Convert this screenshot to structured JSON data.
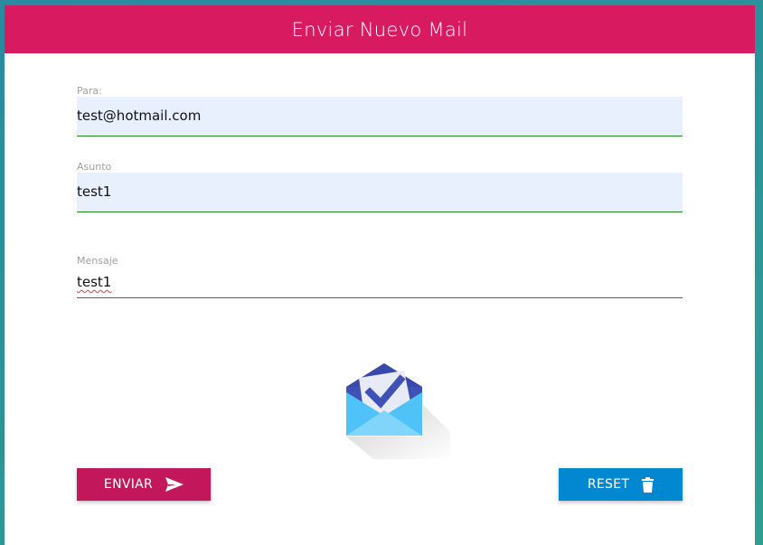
{
  "header": {
    "title": "Enviar Nuevo Mail"
  },
  "form": {
    "to": {
      "label": "Para:",
      "value": "test@hotmail.com"
    },
    "subject": {
      "label": "Asunto",
      "value": "test1"
    },
    "message": {
      "label": "Mensaje",
      "value": "test1"
    }
  },
  "logo": {
    "icon": "inbox-envelope-check-icon"
  },
  "buttons": {
    "send": {
      "label": "ENVIAR",
      "icon": "send-icon"
    },
    "reset": {
      "label": "RESET",
      "icon": "trash-icon"
    }
  },
  "colors": {
    "header": "#d81b60",
    "send_button": "#c2185b",
    "reset_button": "#0288d1",
    "field_fill": "#e8f0fd",
    "field_underline": "#1b8a1b"
  }
}
